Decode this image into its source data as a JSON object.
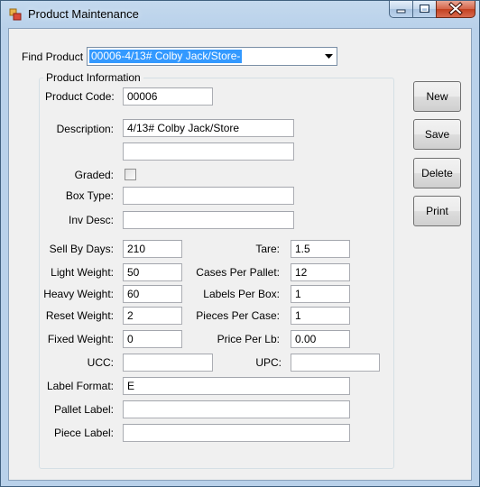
{
  "window": {
    "title": "Product Maintenance"
  },
  "find": {
    "label": "Find Product",
    "selected": "00006-4/13# Colby Jack/Store-"
  },
  "group": {
    "title": "Product Information",
    "product_code": {
      "label": "Product Code:",
      "value": "00006"
    },
    "description": {
      "label": "Description:",
      "value": "4/13# Colby Jack/Store",
      "value2": ""
    },
    "graded": {
      "label": "Graded:",
      "checked": false
    },
    "box_type": {
      "label": "Box Type:",
      "value": ""
    },
    "inv_desc": {
      "label": "Inv Desc:",
      "value": ""
    },
    "sell_by_days": {
      "label": "Sell By Days:",
      "value": "210"
    },
    "light_weight": {
      "label": "Light Weight:",
      "value": "50"
    },
    "heavy_weight": {
      "label": "Heavy Weight:",
      "value": "60"
    },
    "reset_weight": {
      "label": "Reset Weight:",
      "value": "2"
    },
    "fixed_weight": {
      "label": "Fixed Weight:",
      "value": "0"
    },
    "tare": {
      "label": "Tare:",
      "value": "1.5"
    },
    "cases_per_pallet": {
      "label": "Cases Per Pallet:",
      "value": "12"
    },
    "labels_per_box": {
      "label": "Labels Per Box:",
      "value": "1"
    },
    "pieces_per_case": {
      "label": "Pieces Per Case:",
      "value": "1"
    },
    "price_per_lb": {
      "label": "Price Per Lb:",
      "value": "0.00"
    },
    "ucc": {
      "label": "UCC:",
      "value": ""
    },
    "upc": {
      "label": "UPC:",
      "value": ""
    },
    "label_format": {
      "label": "Label Format:",
      "value": "E"
    },
    "pallet_label": {
      "label": "Pallet Label:",
      "value": ""
    },
    "piece_label": {
      "label": "Piece Label:",
      "value": ""
    }
  },
  "buttons": {
    "new": "New",
    "save": "Save",
    "delete": "Delete",
    "print": "Print"
  },
  "colors": {
    "selection": "#3399ff",
    "client": "#f0f0f0",
    "frame": "#b9d1ea",
    "close": "#c2401f"
  }
}
